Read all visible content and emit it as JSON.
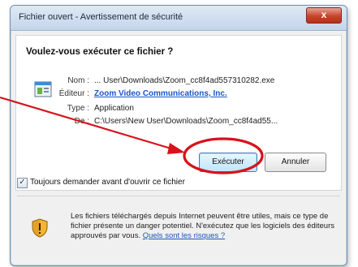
{
  "window": {
    "title": "Fichier ouvert - Avertissement de sécurité",
    "close_glyph": "x"
  },
  "dialog": {
    "question": "Voulez-vous exécuter ce fichier ?",
    "properties": [
      {
        "label": "Nom :",
        "value": "... User\\Downloads\\Zoom_cc8f4ad557310282.exe",
        "is_link": false
      },
      {
        "label": "Éditeur :",
        "value": "Zoom Video Communications, Inc.",
        "is_link": true
      },
      {
        "label": "Type :",
        "value": "Application",
        "is_link": false
      },
      {
        "label": "De :",
        "value": "C:\\Users\\New User\\Downloads\\Zoom_cc8f4ad55...",
        "is_link": false
      }
    ],
    "buttons": {
      "run": "Exécuter",
      "cancel": "Annuler"
    },
    "checkbox": {
      "label": "Toujours demander avant d'ouvrir ce fichier",
      "checked": true,
      "check_glyph": "✓"
    },
    "warning": {
      "text": "Les fichiers téléchargés depuis Internet peuvent être utiles, mais ce type de fichier présente un danger potentiel. N'exécutez que les logiciels des éditeurs approuvés par vous.",
      "link": "Quels sont les risques ?"
    }
  },
  "annotation": {
    "color": "#d8121b"
  },
  "icons": {
    "app": "application-icon",
    "shield": "security-shield-icon",
    "close": "close-icon"
  }
}
